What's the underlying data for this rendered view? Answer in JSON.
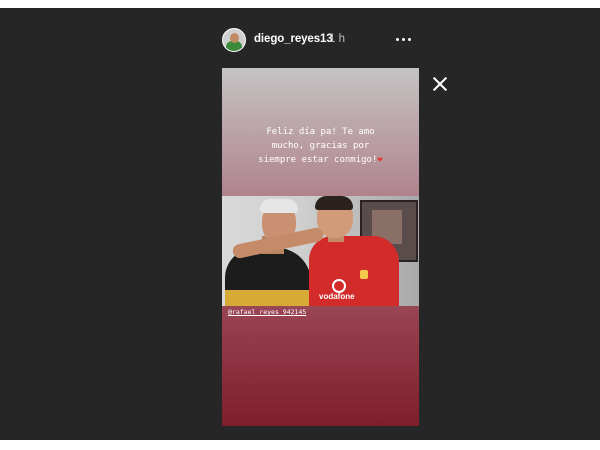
{
  "header": {
    "username": "diego_reyes13",
    "time": "1 h",
    "more_icon": "more-horizontal-icon",
    "close_icon": "close-icon"
  },
  "story": {
    "caption": "Feliz día pa! Te amo\nmucho, gracias por\nsiempre estar conmigo!",
    "emoji": "❤",
    "mention": "@rafael_reyes_942145",
    "photo_shirt_text": "vodafone"
  },
  "colors": {
    "viewer_bg": "#262626",
    "story_top": "#c4c3c3",
    "story_bottom": "#7e1e2b",
    "heart": "#e53935"
  }
}
